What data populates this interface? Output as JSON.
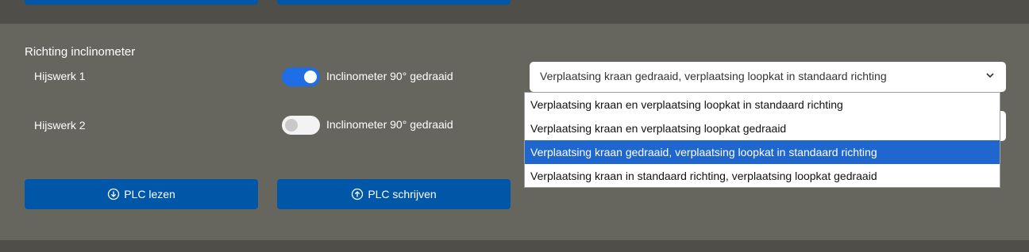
{
  "section": {
    "title": "Richting inclinometer"
  },
  "rows": [
    {
      "label": "Hijswerk 1",
      "toggle_label": "Inclinometer 90° gedraaid",
      "toggle_on": true
    },
    {
      "label": "Hijswerk 2",
      "toggle_label": "Inclinometer 90° gedraaid",
      "toggle_on": false
    }
  ],
  "select": {
    "value": "Verplaatsing kraan gedraaid, verplaatsing loopkat in standaard richting",
    "options": [
      "Verplaatsing kraan en verplaatsing loopkat in standaard richting",
      "Verplaatsing kraan en verplaatsing loopkat gedraaid",
      "Verplaatsing kraan gedraaid, verplaatsing loopkat in standaard richting",
      "Verplaatsing kraan in standaard richting, verplaatsing loopkat gedraaid"
    ],
    "selected_index": 2
  },
  "buttons": {
    "read": {
      "label": "PLC lezen",
      "icon": "arrow-down-circle-icon"
    },
    "write": {
      "label": "PLC schrijven",
      "icon": "arrow-up-circle-icon"
    }
  },
  "colors": {
    "primary_button": "#0057a8",
    "toggle_on": "#1e6fe6",
    "option_highlight": "#1f66cf",
    "panel_bg": "#67665e",
    "page_bg": "#4f4e48"
  }
}
